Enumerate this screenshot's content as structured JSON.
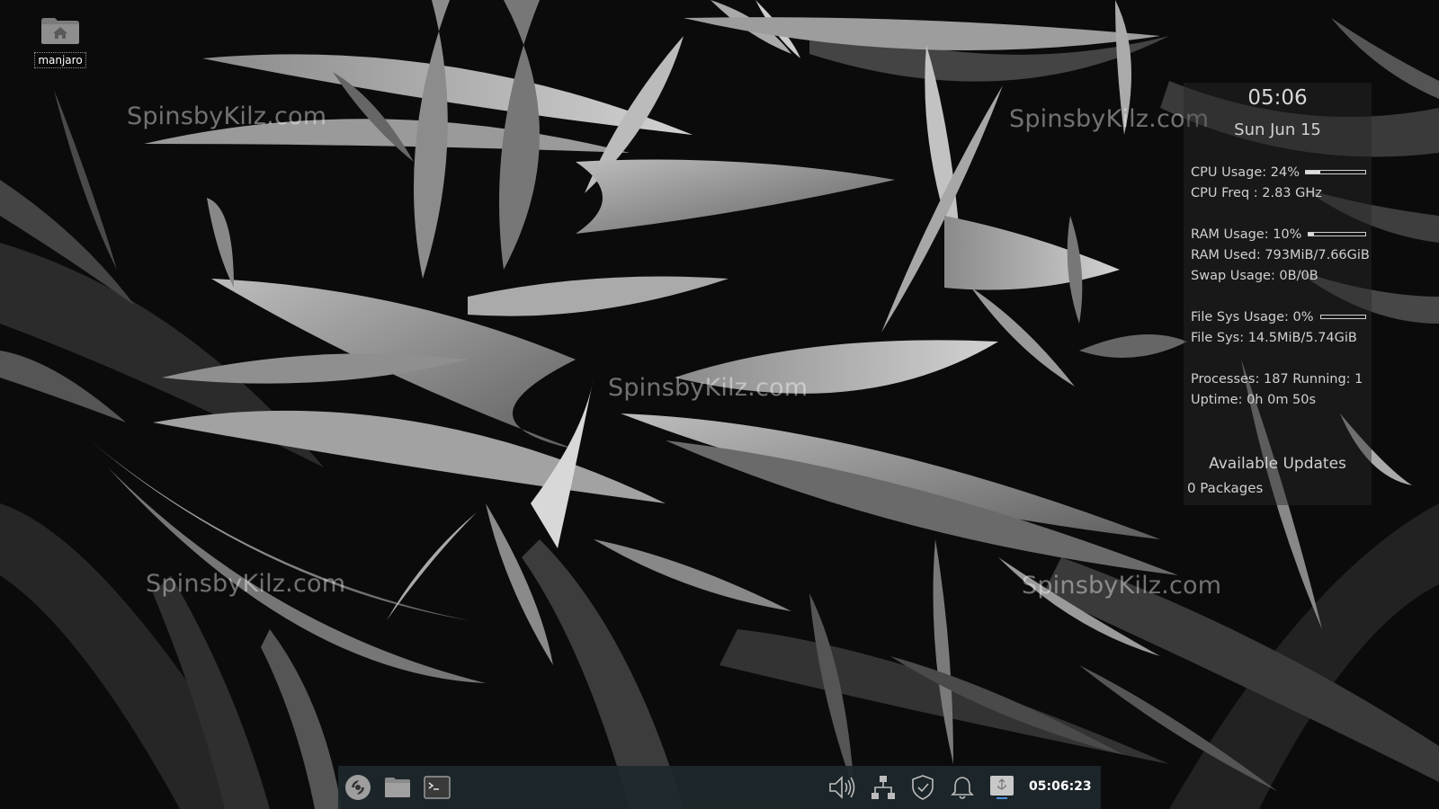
{
  "desktop": {
    "home_icon_label": "manjaro",
    "watermark_text": "SpinsbyKilz.com"
  },
  "conky": {
    "time": "05:06",
    "date": "Sun Jun 15",
    "cpu_usage": "CPU Usage: 24%",
    "cpu_usage_fraction": 0.24,
    "cpu_freq": "CPU Freq : 2.83 GHz",
    "ram_usage": "RAM Usage: 10%",
    "ram_usage_fraction": 0.1,
    "ram_used": "RAM Used: 793MiB/7.66GiB",
    "swap_usage": "Swap Usage: 0B/0B",
    "fs_usage": "File Sys Usage:  0%",
    "fs_usage_fraction": 0.0,
    "fs": "File Sys: 14.5MiB/5.74GiB",
    "processes": "Processes: 187   Running: 1",
    "uptime": "Uptime: 0h 0m 50s",
    "updates_title": "Available Updates",
    "updates_value": "0 Packages"
  },
  "taskbar": {
    "clock": "05:06:23",
    "launchers": [
      "manjaro-menu-icon",
      "file-manager-icon",
      "terminal-icon"
    ],
    "tray": [
      "volume-icon",
      "network-icon",
      "shield-icon",
      "notification-bell-icon",
      "usb-drive-icon"
    ]
  },
  "colors": {
    "taskbar_bg": "#1e282c",
    "conky_text": "#d0d0d0",
    "tray_highlight": "#4a90d9"
  }
}
